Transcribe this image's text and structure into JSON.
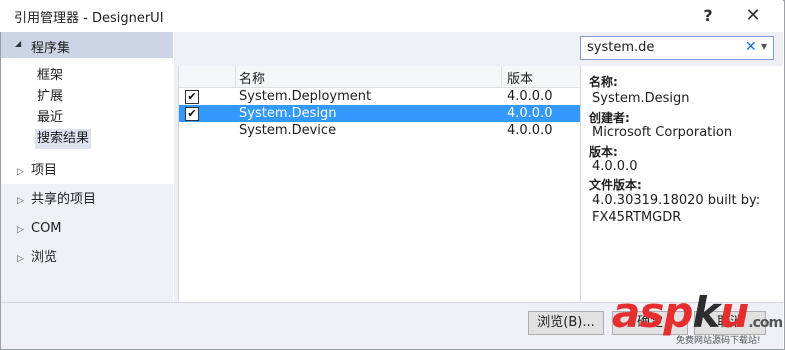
{
  "window": {
    "title": "引用管理器 - DesignerUI",
    "help_glyph": "?",
    "close_glyph": "✕"
  },
  "left_pane": {
    "header": "程序集",
    "sub_items": [
      "框架",
      "扩展",
      "最近",
      "搜索结果"
    ],
    "nodes": [
      "项目",
      "共享的项目",
      "COM",
      "浏览"
    ]
  },
  "search": {
    "value": "system.de",
    "clear_glyph": "✕"
  },
  "list": {
    "columns": {
      "name": "名称",
      "version": "版本"
    },
    "rows": [
      {
        "checked": true,
        "name": "System.Deployment",
        "version": "4.0.0.0"
      },
      {
        "checked": true,
        "name": "System.Design",
        "version": "4.0.0.0"
      },
      {
        "checked": false,
        "name": "System.Device",
        "version": "4.0.0.0"
      }
    ]
  },
  "details": {
    "name_label": "名称:",
    "name_value": "System.Design",
    "creator_label": "创建者:",
    "creator_value": "Microsoft Corporation",
    "version_label": "版本:",
    "version_value": "4.0.0.0",
    "file_version_label": "文件版本:",
    "file_version_value_1": "4.0.30319.18020 built by:",
    "file_version_value_2": "FX45RTMGDR"
  },
  "buttons": {
    "browse": "浏览(B)...",
    "ok": "确定",
    "cancel": "取消"
  },
  "watermark": {
    "logo_a": "asp",
    "logo_b": "k",
    "logo_c": "u",
    "domain": ".com",
    "subtitle": "免费网站源码下载站!"
  },
  "colors": {
    "selection": "#3399ff",
    "header_bg": "#cdd4e6",
    "pane_bg": "#eef0f6"
  }
}
